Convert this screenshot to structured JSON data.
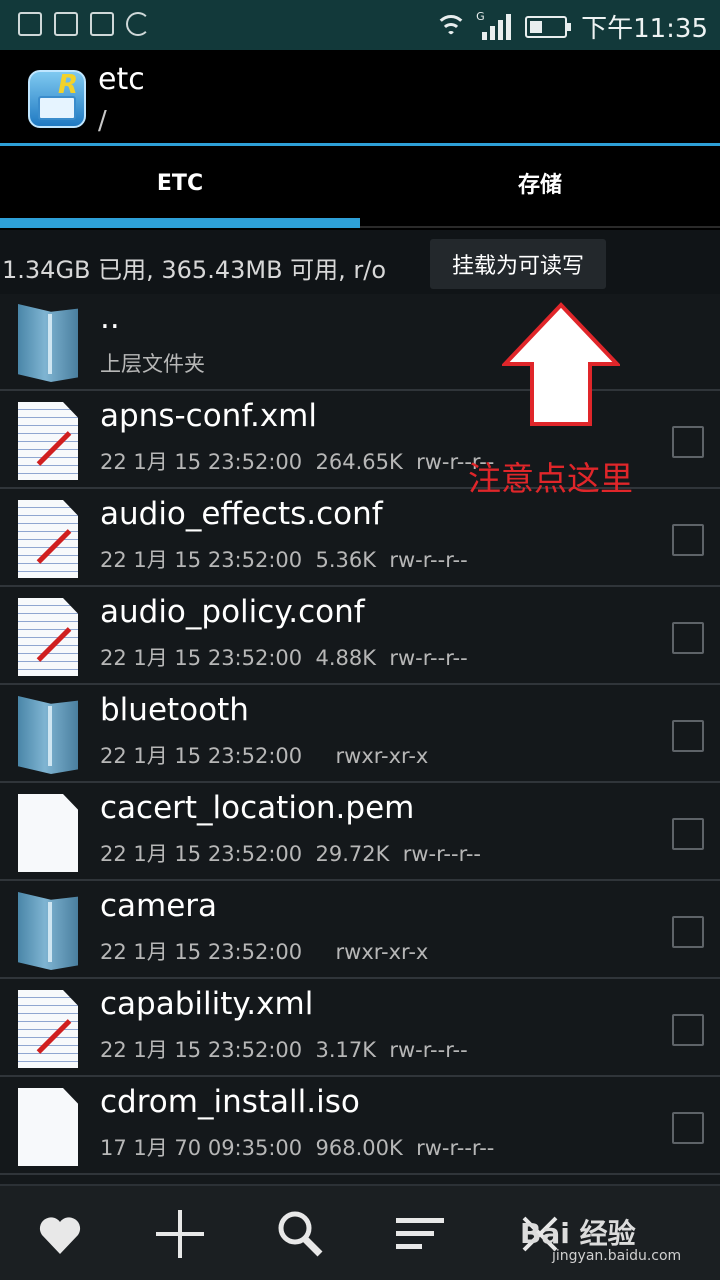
{
  "status_bar": {
    "time": "下午11:35",
    "network_type": "G",
    "left_icons": [
      "alert-icon",
      "image-icon",
      "keyboard-icon",
      "sync-icon"
    ]
  },
  "header": {
    "title": "etc",
    "path": "/"
  },
  "tabs": [
    {
      "label": "ETC",
      "active": true
    },
    {
      "label": "存储",
      "active": false
    }
  ],
  "storage": {
    "info": "1.34GB 已用, 365.43MB 可用, r/o",
    "mount_button": "挂载为可读写"
  },
  "files": [
    {
      "name": "..",
      "meta": "上层文件夹",
      "type": "folder"
    },
    {
      "name": "apns-conf.xml",
      "meta": "22 1月 15 23:52:00  264.65K  rw-r--r--",
      "type": "text"
    },
    {
      "name": "audio_effects.conf",
      "meta": "22 1月 15 23:52:00  5.36K  rw-r--r--",
      "type": "text"
    },
    {
      "name": "audio_policy.conf",
      "meta": "22 1月 15 23:52:00  4.88K  rw-r--r--",
      "type": "text"
    },
    {
      "name": "bluetooth",
      "meta": "22 1月 15 23:52:00     rwxr-xr-x",
      "type": "folder"
    },
    {
      "name": "cacert_location.pem",
      "meta": "22 1月 15 23:52:00  29.72K  rw-r--r--",
      "type": "file"
    },
    {
      "name": "camera",
      "meta": "22 1月 15 23:52:00     rwxr-xr-x",
      "type": "folder"
    },
    {
      "name": "capability.xml",
      "meta": "22 1月 15 23:52:00  3.17K  rw-r--r--",
      "type": "text"
    },
    {
      "name": "cdrom_install.iso",
      "meta": "17 1月 70 09:35:00  968.00K  rw-r--r--",
      "type": "file"
    }
  ],
  "annotation": {
    "text": "注意点这里",
    "color": "#e0262a"
  },
  "bottom_bar": {
    "buttons": [
      "favorite-icon",
      "add-icon",
      "search-icon",
      "sort-icon",
      "select-icon"
    ]
  },
  "watermark": {
    "logo": "Bai 经验",
    "url": "jingyan.baidu.com"
  },
  "colors": {
    "accent": "#2ea0d8",
    "status_bar": "#12393a",
    "background": "#14181b"
  }
}
